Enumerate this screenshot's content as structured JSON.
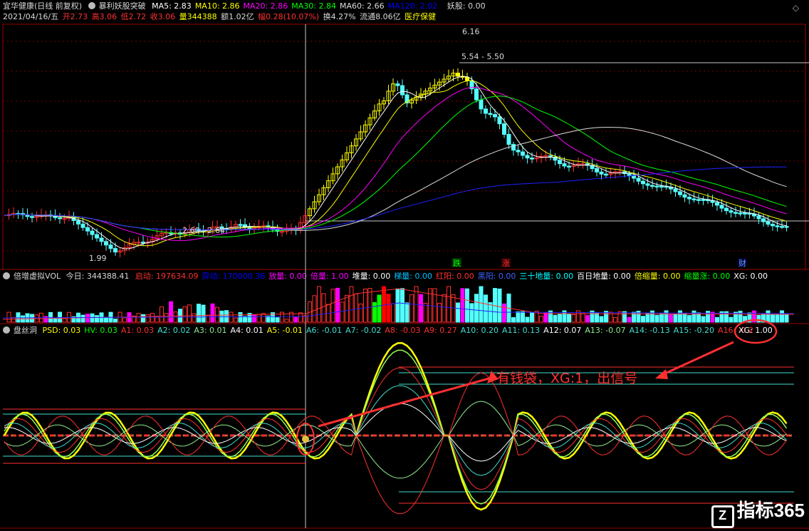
{
  "main": {
    "title": "宜华健康(日线 前复权)",
    "indicator_name": "暴利妖股突破",
    "ma": [
      {
        "label": "MA5: 2.83",
        "color": "#ffffff"
      },
      {
        "label": "MA10: 2.86",
        "color": "#ffff00"
      },
      {
        "label": "MA20: 2.86",
        "color": "#ff00ff"
      },
      {
        "label": "MA30: 2.84",
        "color": "#00ff00"
      },
      {
        "label": "MA60: 2.66",
        "color": "#dddddd"
      },
      {
        "label": "MA120: 2.02",
        "color": "#0000ff"
      }
    ],
    "yaogu": "妖股: 0.00",
    "info": {
      "date": "2021/04/16/五",
      "open_label": "开",
      "open": "2.73",
      "high_label": "高",
      "high": "3.06",
      "low_label": "低",
      "low": "2.72",
      "close_label": "收",
      "close": "3.06",
      "vol_label": "量",
      "vol": "344388",
      "amount_label": "额",
      "amount": "1.02亿",
      "chg_label": "幅",
      "chg": "0.28(10.07%)",
      "turnover": "换4.27%",
      "float_cap": "流通8.06亿",
      "sector": "医疗保健"
    },
    "annotations": {
      "peak": "6.16",
      "range_high": "5.54 - 5.50",
      "range_low": "2.60 - 2.64",
      "bottom": "1.99",
      "marker_die": "跌",
      "marker_zhang": "涨",
      "marker_cai": "财"
    }
  },
  "volume": {
    "name": "倍增虚拟VOL",
    "today": "今日: 344388.41",
    "items": [
      {
        "label": "启动: 197634.09",
        "color": "#ff3030"
      },
      {
        "label": "异动: 170000.36",
        "color": "#0000ff"
      },
      {
        "label": "放量: 0.00",
        "color": "#ff00ff"
      },
      {
        "label": "倍量: 1.00",
        "color": "#ff00ff"
      },
      {
        "label": "堆量: 0.00",
        "color": "#ffffff"
      },
      {
        "label": "梯量: 0.00",
        "color": "#00c0ff"
      },
      {
        "label": "红阳: 0.00",
        "color": "#ff3030"
      },
      {
        "label": "黑阳: 0.00",
        "color": "#4060ff"
      },
      {
        "label": "三十地量: 0.00",
        "color": "#00ffff"
      },
      {
        "label": "百日地量: 0.00",
        "color": "#ffffff"
      },
      {
        "label": "倍缩量: 0.00",
        "color": "#ffff00"
      },
      {
        "label": "缩量涨: 0.00",
        "color": "#00ff00"
      },
      {
        "label": "XG: 0.00",
        "color": "#ffffff"
      }
    ]
  },
  "osc": {
    "name": "盘丝洞",
    "items": [
      {
        "label": "PSD: 0.03",
        "color": "#ffff00"
      },
      {
        "label": "HV: 0.03",
        "color": "#00ff00"
      },
      {
        "label": "A1: 0.03",
        "color": "#ff3030"
      },
      {
        "label": "A2: 0.02",
        "color": "#40e0d0"
      },
      {
        "label": "A3: 0.01",
        "color": "#90ee90"
      },
      {
        "label": "A4: 0.01",
        "color": "#ffffff"
      },
      {
        "label": "A5: -0.01",
        "color": "#ffff00"
      },
      {
        "label": "A6: -0.01",
        "color": "#40e0d0"
      },
      {
        "label": "A7: -0.02",
        "color": "#40e0d0"
      },
      {
        "label": "A8: -0.03",
        "color": "#ff3030"
      },
      {
        "label": "A9: 0.27",
        "color": "#ff3030"
      },
      {
        "label": "A10: 0.20",
        "color": "#40e0d0"
      },
      {
        "label": "A11: 0.13",
        "color": "#40e0d0"
      },
      {
        "label": "A12: 0.07",
        "color": "#ffffff"
      },
      {
        "label": "A13: -0.07",
        "color": "#90ee90"
      },
      {
        "label": "A14: -0.13",
        "color": "#40e0d0"
      },
      {
        "label": "A15: -0.20",
        "color": "#40e0d0"
      },
      {
        "label": "A16: -0.2",
        "color": "#ff3030"
      }
    ],
    "xg": "XG: 1.00",
    "callout": "有钱袋，XG:1，出信号"
  },
  "brand": "指标365",
  "colors": {
    "up": "#ff3030",
    "down": "#54ffff",
    "yellow": "#ffff00",
    "grid": "#7a0000",
    "axis": "#9a0000"
  }
}
